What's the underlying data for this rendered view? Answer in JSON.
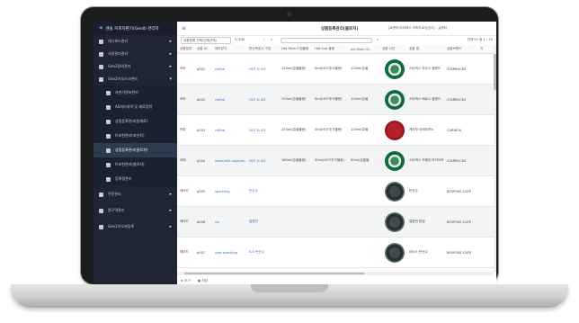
{
  "app": {
    "title": "렌솔 커피자판기(GenⅡ) 관리자",
    "page_title": "상품등록관리(클로저)",
    "user_info": "[로렌커/우리베스 커피드로잉센스] - 실행하",
    "menu_icon": "hamburger-icon"
  },
  "sidebar": {
    "items": [
      {
        "label": "대시보드관리",
        "icon": "dashboard-icon"
      },
      {
        "label": "사용관리관리",
        "icon": "users-icon"
      },
      {
        "label": "Gen2장비관리",
        "icon": "car-icon"
      },
      {
        "label": "Gen2키오스크관리",
        "icon": "lock-icon",
        "expanded": true
      }
    ],
    "subitems": [
      {
        "label": "자판기정보관리",
        "icon": "monitor-icon"
      },
      {
        "label": "AS처리내역 및 재료입력",
        "icon": "headset-icon"
      },
      {
        "label": "상품등록관리(원재료)",
        "icon": "people-icon"
      },
      {
        "label": "트러쳔관리(포인트)",
        "icon": "doc-icon"
      },
      {
        "label": "상품등록관리(클로저)",
        "icon": "people-icon",
        "active": true
      },
      {
        "label": "트러쳔관리(클로저)",
        "icon": "doc-icon"
      },
      {
        "label": "등록정관리",
        "icon": "people-icon"
      }
    ],
    "bottom_items": [
      {
        "label": "주문관리",
        "icon": "orders-icon"
      },
      {
        "label": "원구역관리",
        "icon": "area-icon"
      },
      {
        "label": "Gen1키오쳐등록",
        "icon": "kiosk-icon"
      }
    ]
  },
  "toolbar": {
    "select_value": "상품등록 선택(전체선택)",
    "refresh_label": "조회",
    "count_label": "전체 97 중 1 - 25"
  },
  "table": {
    "headers": [
      "상품분류",
      "상품 ID",
      "제조방식",
      "판선택표시 구분",
      "Hot Main 드럼물량",
      "Hot Sub 물량",
      "Ice Main (G)",
      "상품 사진",
      "상품 명",
      "상품브랜드",
      "지"
    ],
    "rows": [
      {
        "cells": [
          "커피",
          "p001",
          "coffee",
          "HOT & ICE",
          "255ml(쥬물물량)",
          "0ml(HOT추가물량)",
          "120ml(쥬물"
        ],
        "pod": "green",
        "name": "스타벅스 하우스 블렌드",
        "brand": "STARBUCKS"
      },
      {
        "cells": [
          "커피",
          "p002",
          "coffee",
          "HOT & ICE",
          "255ml(쥬물물량)",
          "0ml(HOT추가물량)",
          "120ml(쥬물"
        ],
        "pod": "green",
        "name": "스타벅스 베로나 블렌드",
        "brand": "STARBUCKS"
      },
      {
        "cells": [
          "커피",
          "p003",
          "coffee",
          "HOT & ICE",
          "255ml(쥬물물량)",
          "0ml(HOT추가물량)",
          "120ml(쥬물"
        ],
        "pod": "red",
        "name": "캐리보 아메리카노",
        "brand": "CARIBOU"
      },
      {
        "cells": [
          "라떼",
          "p004",
          "latte(milk capsule)",
          "HOT & ICE",
          "180ml(쥬물물량)",
          "30ml(HOT추가물량)",
          "60ml(쥬물물"
        ],
        "pod": "green",
        "name": "스타벅스 카페라 마키아또",
        "brand": "STARBUCKS"
      },
      {
        "cells": [
          "에이드",
          "p005",
          "sparkling",
          "탄산수",
          "",
          "",
          "",
          ""
        ],
        "pod": "dark",
        "name": "탄산수",
        "brand": "BESPOKE CAFE"
      },
      {
        "cells": [
          "에이드",
          "p006",
          "ice",
          "얼음만",
          "",
          "",
          "",
          ""
        ],
        "pod": "dark",
        "name": "얼음만 한컵",
        "brand": "BESPOKE CAFE"
      },
      {
        "cells": [
          "에이드",
          "p007",
          "iced sparkling",
          "ICE 탄산수",
          "",
          "",
          "",
          ""
        ],
        "pod": "dark",
        "name": "아이스 탄산수",
        "brand": "BESPOKE CAFE"
      }
    ]
  },
  "footer": {
    "add_label": "추가",
    "save_label": "저장"
  }
}
